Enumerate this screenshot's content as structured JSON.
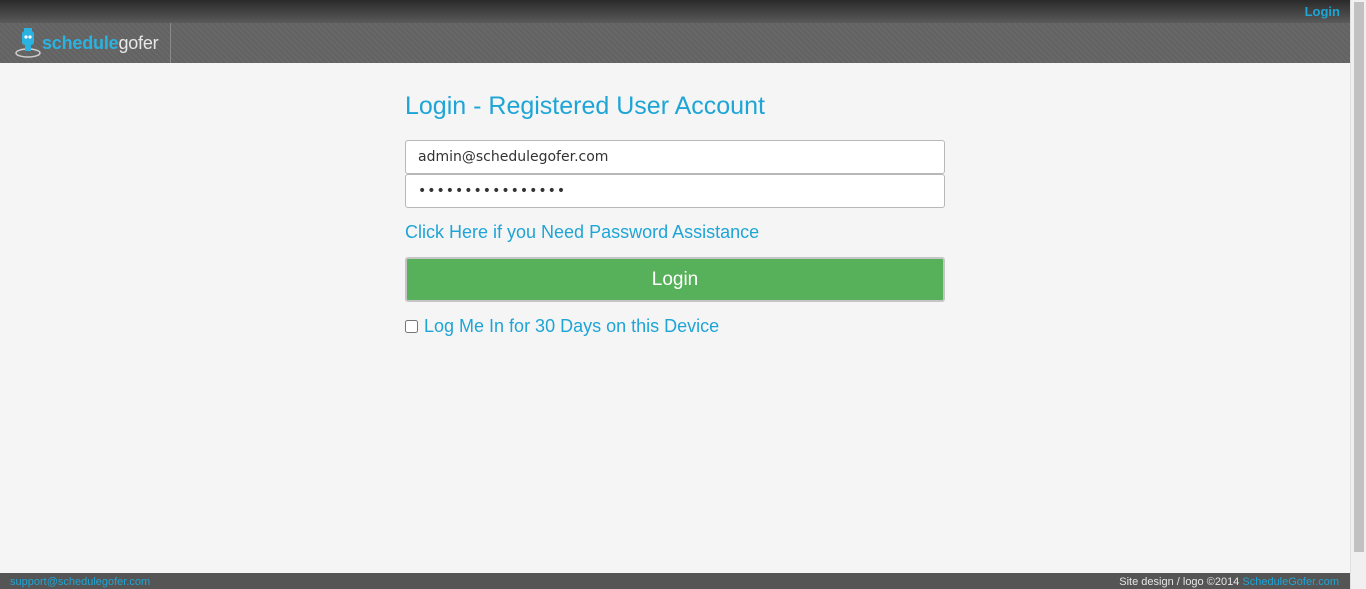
{
  "topbar": {
    "login_label": "Login"
  },
  "header": {
    "logo": {
      "part1": "schedule",
      "part2": "gofer"
    }
  },
  "colors": {
    "accent": "#1ea5d6",
    "button_green": "#57b15a",
    "header_bg": "#646464",
    "footer_bg": "#555555"
  },
  "main": {
    "title": "Login - Registered User Account",
    "email_value": "admin@schedulegofer.com",
    "password_value": "••••••••••••••••",
    "assist_link": "Click Here if you Need Password Assistance",
    "login_button": "Login",
    "remember_label": "Log Me In for 30 Days on this Device"
  },
  "footer": {
    "support_email": "support@schedulegofer.com",
    "credit_text": "Site design / logo ©2014",
    "credit_link": "ScheduleGofer.com"
  }
}
